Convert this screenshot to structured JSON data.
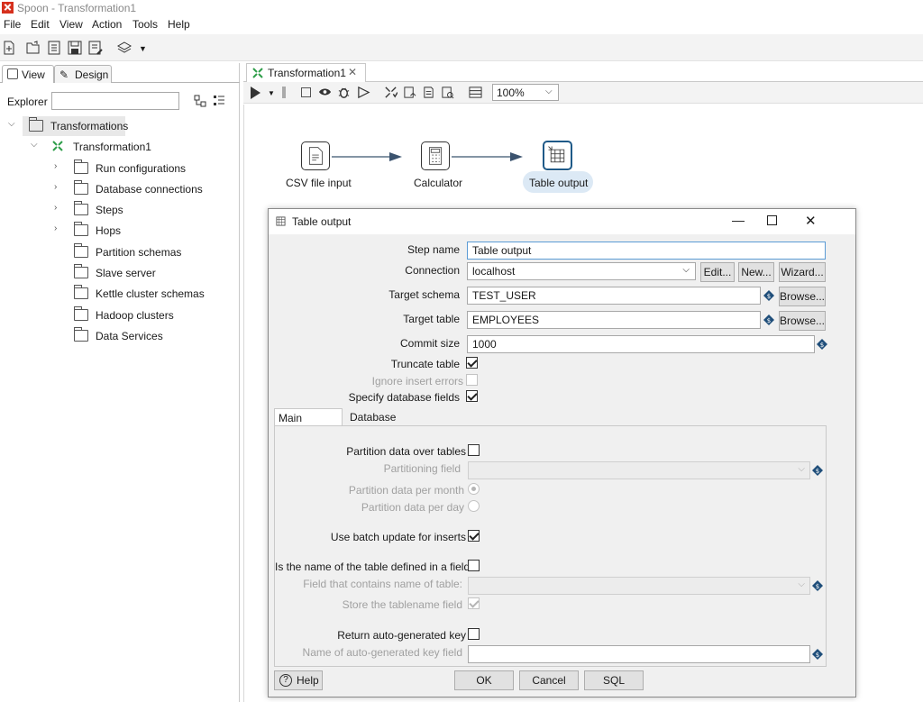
{
  "window": {
    "title": "Spoon - Transformation1"
  },
  "menu": [
    "File",
    "Edit",
    "View",
    "Action",
    "Tools",
    "Help"
  ],
  "left_panel": {
    "tabs": [
      "View",
      "Design"
    ],
    "explorer_label": "Explorer",
    "tree": {
      "root": "Transformations",
      "transformation": "Transformation1",
      "children": [
        "Run configurations",
        "Database connections",
        "Steps",
        "Hops",
        "Partition schemas",
        "Slave server",
        "Kettle cluster schemas",
        "Hadoop clusters",
        "Data Services"
      ]
    }
  },
  "editor": {
    "tab_label": "Transformation1",
    "zoom": "100%",
    "steps": [
      "CSV file input",
      "Calculator",
      "Table output"
    ]
  },
  "dialog": {
    "title": "Table output",
    "step_name_label": "Step name",
    "step_name": "Table output",
    "connection_label": "Connection",
    "connection": "localhost",
    "edit_btn": "Edit...",
    "new_btn": "New...",
    "wizard_btn": "Wizard...",
    "target_schema_label": "Target schema",
    "target_schema": "TEST_USER",
    "target_table_label": "Target table",
    "target_table": "EMPLOYEES",
    "browse_btn": "Browse...",
    "commit_size_label": "Commit size",
    "commit_size": "1000",
    "truncate_label": "Truncate table",
    "ignore_errors_label": "Ignore insert errors",
    "specify_fields_label": "Specify database fields",
    "tabs": [
      "Main options",
      "Database fields"
    ],
    "main": {
      "partition_label": "Partition data over tables",
      "partitioning_field_label": "Partitioning field",
      "per_month_label": "Partition data per month",
      "per_day_label": "Partition data per day",
      "batch_label": "Use batch update for inserts",
      "name_in_field_label": "Is the name of the table defined in a field?",
      "field_contains_label": "Field that contains name of table:",
      "store_tablename_label": "Store the tablename field",
      "return_key_label": "Return auto-generated key",
      "key_field_label": "Name of auto-generated key field"
    },
    "help_btn": "Help",
    "ok_btn": "OK",
    "cancel_btn": "Cancel",
    "sql_btn": "SQL"
  }
}
